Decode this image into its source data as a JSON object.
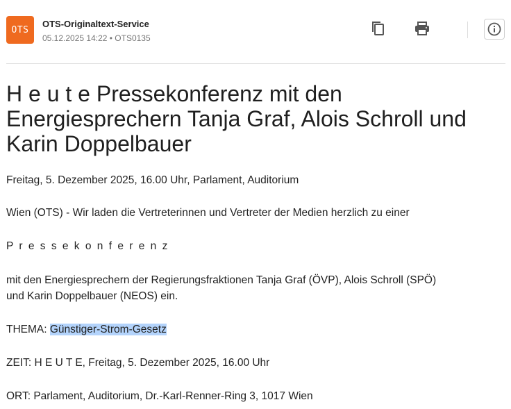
{
  "header": {
    "logo_text": "OTS",
    "source_name": "OTS-Originaltext-Service",
    "meta": "05.12.2025 14:22 • OTS0135",
    "actions": [
      "copy-icon",
      "print-icon",
      "info-icon"
    ]
  },
  "article": {
    "title": "H e u t e Pressekonferenz mit den Energiesprechern Tanja Graf, Alois Schroll und Karin Doppelbauer",
    "subtitle": "Freitag, 5. Dezember 2025, 16.00 Uhr, Parlament, Auditorium",
    "intro": "Wien (OTS) - Wir laden die Vertreterinnen und Vertreter der Medien herzlich zu einer",
    "spaced_word": "P r e s s e k o n f e r e n z",
    "mit_line1": "mit den Energiesprechern der Regierungsfraktionen Tanja Graf (ÖVP), Alois Schroll (SPÖ)",
    "mit_line2": "und Karin Doppelbauer (NEOS) ein.",
    "thema_label": "THEMA: ",
    "thema_value": "Günstiger-Strom-Gesetz",
    "zeit": "ZEIT: H E U T E, Freitag, 5. Dezember 2025, 16.00 Uhr",
    "ort": "ORT: Parlament, Auditorium, Dr.-Karl-Renner-Ring 3, 1017 Wien"
  },
  "colors": {
    "logo": "#ef6a1f",
    "highlight": "#b3d3fb"
  }
}
